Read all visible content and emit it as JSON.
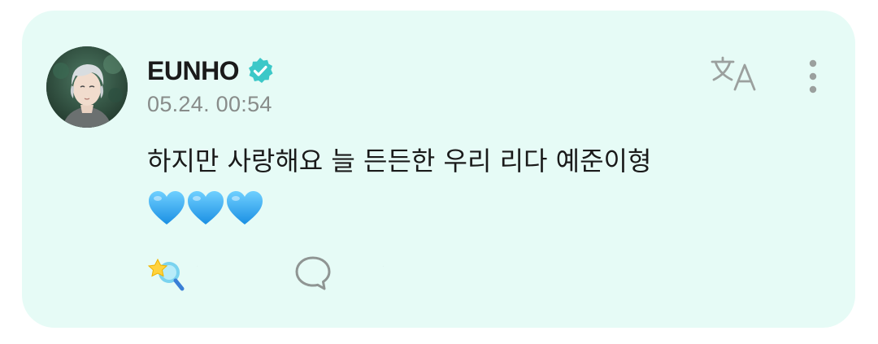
{
  "post": {
    "author": "EUNHO",
    "verified": true,
    "timestamp": "05.24. 00:54",
    "text": "하지만 사랑해요 늘 든든한 우리 리다 예준이형",
    "emoji_hearts": [
      "blue-heart",
      "blue-heart",
      "blue-heart"
    ]
  },
  "actions": {
    "translate_icon": "translate-icon",
    "more_icon": "more-vertical-icon",
    "reaction_icon": "star-reaction-icon",
    "reaction_count": "·",
    "comment_icon": "comment-bubble-icon",
    "comment_count": "·"
  },
  "colors": {
    "card_background": "#e6fbf6",
    "verified_badge": "#3cc8c8",
    "text": "#1a1a1a",
    "timestamp": "#888c8a",
    "icon_gray": "#9ba09e",
    "heart_blue": "#2aa8f0"
  }
}
